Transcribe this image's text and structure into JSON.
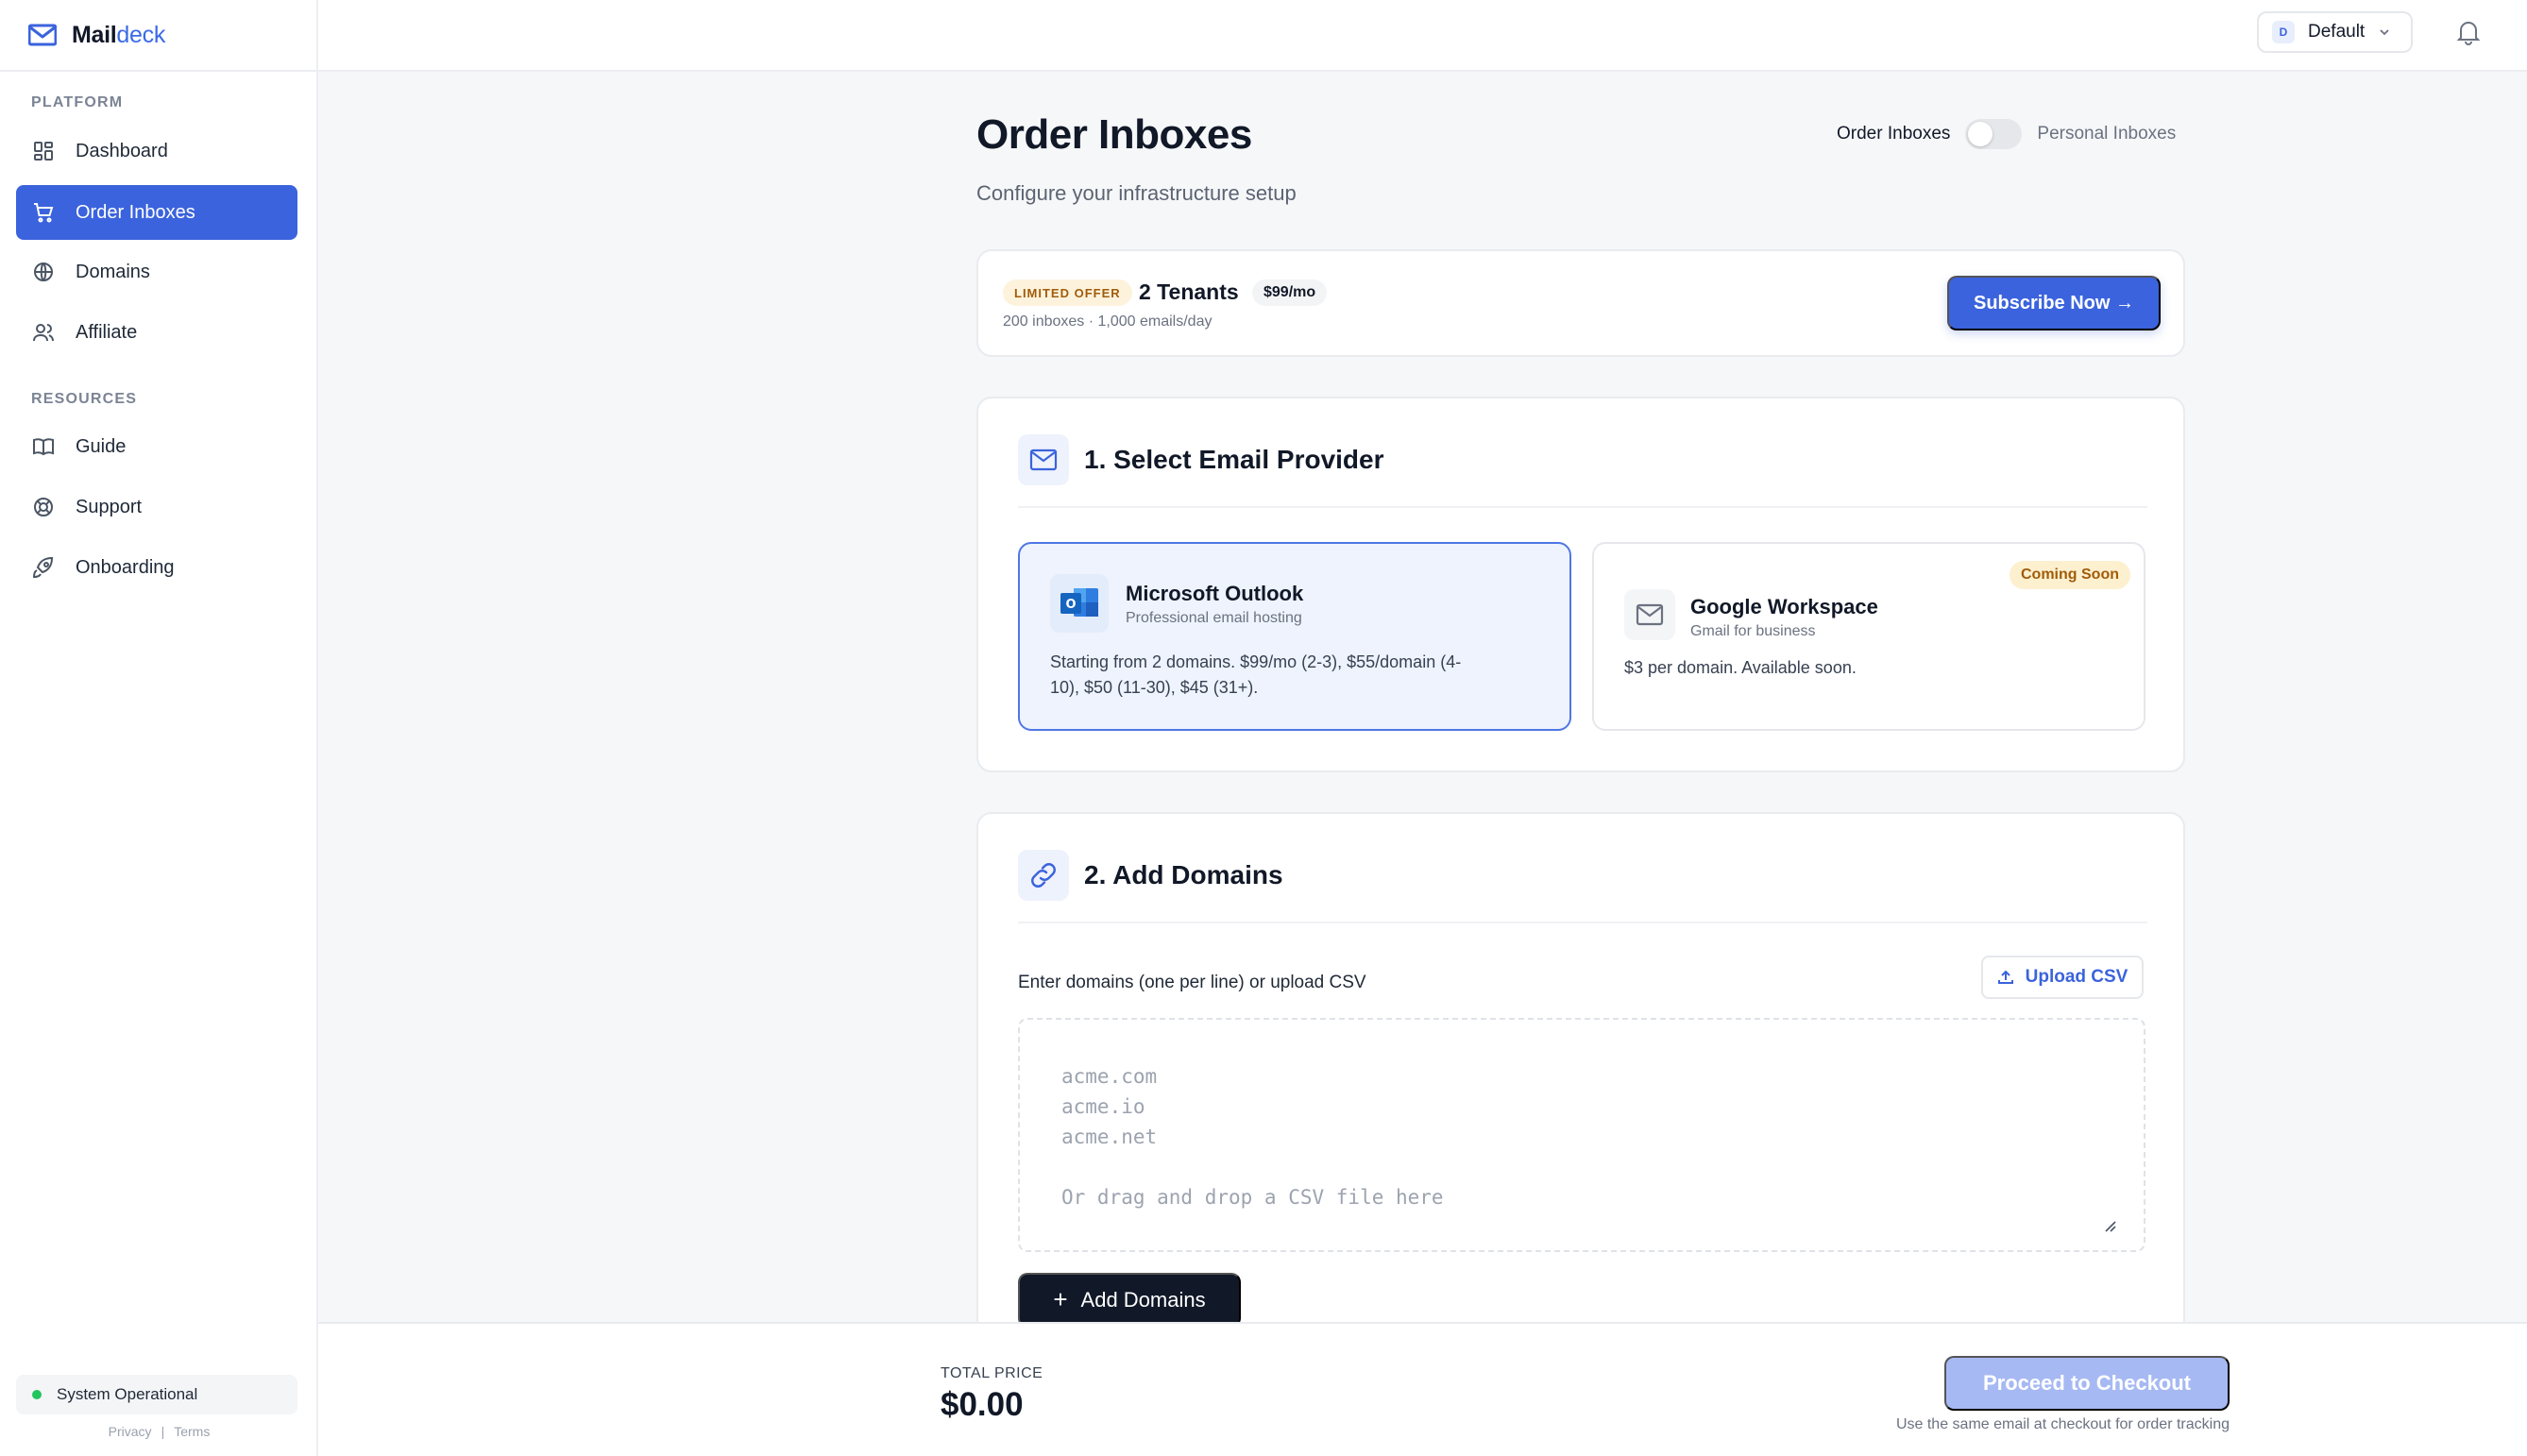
{
  "brand": {
    "name_part1": "Mail",
    "name_part2": "deck"
  },
  "sidebar": {
    "sections": [
      {
        "label": "PLATFORM"
      },
      {
        "label": "RESOURCES"
      }
    ],
    "items": [
      {
        "label": "Dashboard",
        "icon": "grid-icon"
      },
      {
        "label": "Order Inboxes",
        "icon": "cart-icon",
        "active": true
      },
      {
        "label": "Domains",
        "icon": "globe-icon"
      },
      {
        "label": "Affiliate",
        "icon": "users-icon"
      },
      {
        "label": "Guide",
        "icon": "book-icon"
      },
      {
        "label": "Support",
        "icon": "lifebuoy-icon"
      },
      {
        "label": "Onboarding",
        "icon": "rocket-icon"
      }
    ],
    "status": "System Operational",
    "legal": {
      "privacy": "Privacy",
      "separator": "|",
      "terms": "Terms"
    }
  },
  "topbar": {
    "workspace_initial": "D",
    "workspace_name": "Default"
  },
  "page": {
    "title": "Order Inboxes",
    "subtitle": "Configure your infrastructure setup",
    "toggle": {
      "left_label": "Order Inboxes",
      "right_label": "Personal Inboxes",
      "on": false
    }
  },
  "offer": {
    "tag": "LIMITED OFFER",
    "title": "2 Tenants",
    "price": "$99/mo",
    "meta": "200 inboxes · 1,000 emails/day",
    "cta": "Subscribe Now →"
  },
  "provider_section": {
    "title": "1. Select Email Provider",
    "providers": [
      {
        "name": "Microsoft Outlook",
        "tagline": "Professional email hosting",
        "desc_line1": "Starting from 2 domains. $99/mo (2-3), $55/domain (4-",
        "desc_line2": "10), $50 (11-30), $45 (31+).",
        "selected": true
      },
      {
        "name": "Google Workspace",
        "tagline": "Gmail for business",
        "desc": "$3 per domain. Available soon.",
        "badge": "Coming Soon"
      }
    ]
  },
  "domains_section": {
    "title": "2. Add Domains",
    "label": "Enter domains (one per line) or upload CSV",
    "upload_label": "Upload CSV",
    "placeholder_lines": [
      "acme.com",
      "acme.io",
      "acme.net",
      "",
      "Or drag and drop a CSV file here"
    ],
    "add_label": "Add Domains"
  },
  "footer": {
    "total_label": "TOTAL PRICE",
    "total_value": "$0.00",
    "checkout_label": "Proceed to Checkout",
    "checkout_note": "Use the same email at checkout for order tracking"
  },
  "colors": {
    "accent": "#3b63dd",
    "success": "#22c55e",
    "warning_bg": "#fdf0cf"
  }
}
